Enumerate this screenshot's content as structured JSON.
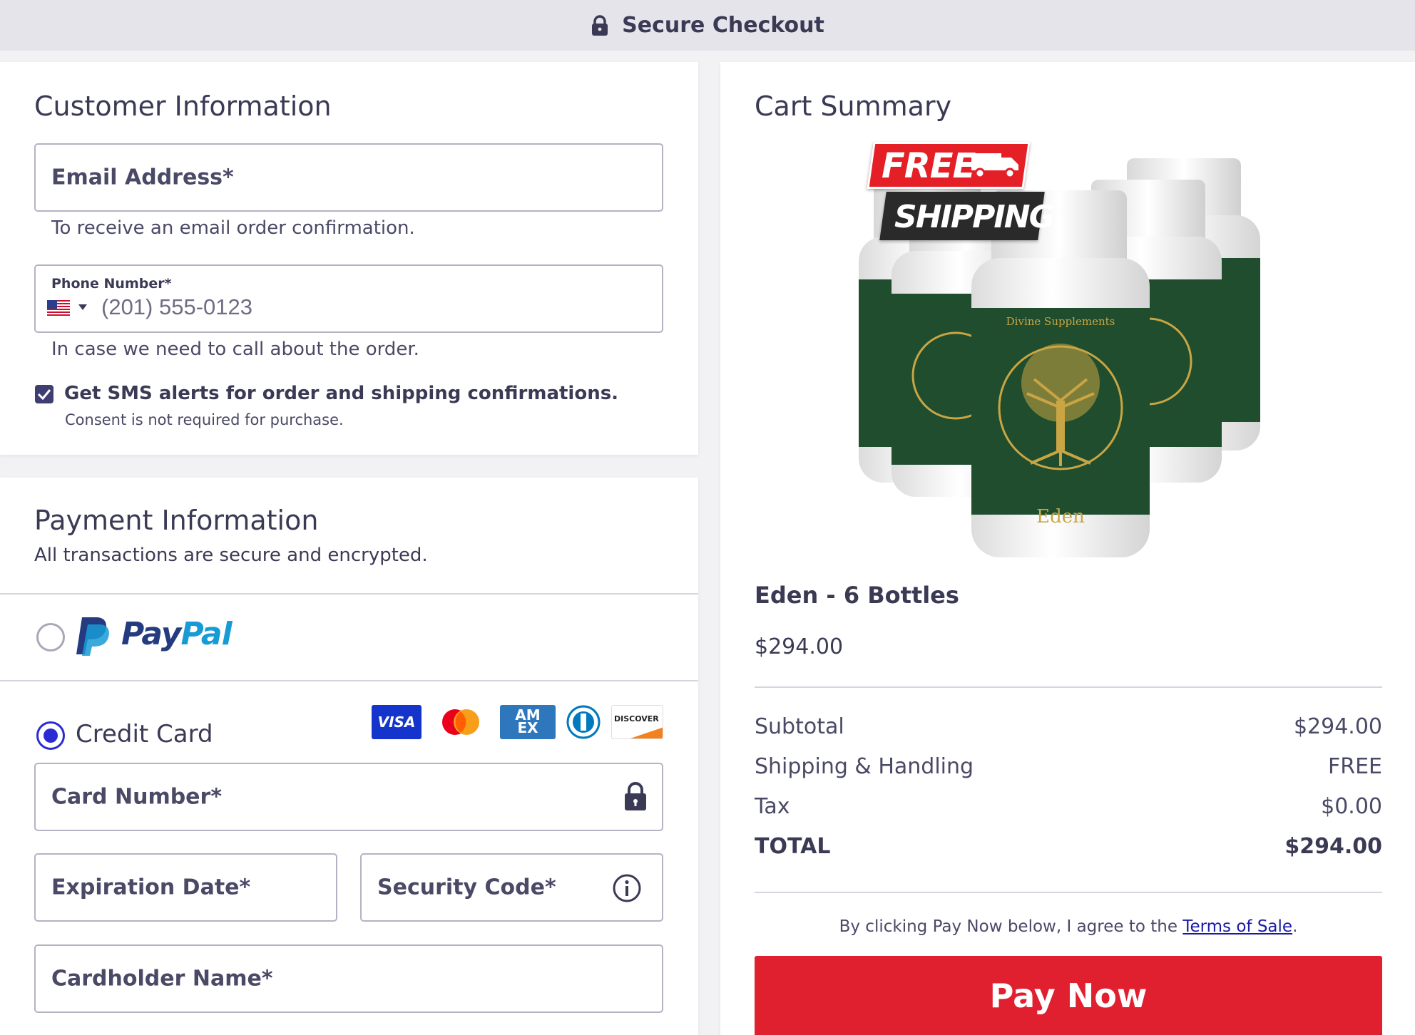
{
  "header": {
    "title": "Secure Checkout",
    "icon": "lock-icon"
  },
  "customer": {
    "heading": "Customer Information",
    "email_label": "Email Address*",
    "email_helper": "To receive an email order confirmation.",
    "phone_label": "Phone Number*",
    "phone_placeholder": "(201) 555-0123",
    "phone_country": "US",
    "phone_helper": "In case we need to call about the order.",
    "sms_label": "Get SMS alerts for order and shipping confirmations.",
    "sms_checked": true,
    "consent_note": "Consent is not required for purchase."
  },
  "payment": {
    "heading": "Payment Information",
    "subheading": "All transactions are secure and encrypted.",
    "paypal": {
      "pay": "Pay",
      "pal": "Pal",
      "selected": false
    },
    "credit_card": {
      "label": "Credit Card",
      "selected": true,
      "logos": {
        "visa": "VISA",
        "amex_top": "AM",
        "amex_bottom": "EX",
        "discover": "DISCOVER"
      }
    },
    "card_number_label": "Card Number*",
    "expiration_label": "Expiration Date*",
    "security_label": "Security Code*",
    "cardholder_label": "Cardholder Name*"
  },
  "cart": {
    "heading": "Cart Summary",
    "badge_free": "FREE",
    "badge_shipping": "SHIPPING",
    "bottle_brand": "Divine Supplements",
    "bottle_name": "Eden",
    "product_name": "Eden - 6 Bottles",
    "product_price": "$294.00",
    "rows": [
      {
        "label": "Subtotal",
        "value": "$294.00"
      },
      {
        "label": "Shipping & Handling",
        "value": "FREE"
      },
      {
        "label": "Tax",
        "value": "$0.00"
      }
    ],
    "total_label": "TOTAL",
    "total_value": "$294.00",
    "terms_prefix": "By clicking Pay Now below, I agree to the ",
    "terms_link": "Terms of Sale",
    "terms_suffix": ".",
    "pay_button": "Pay Now"
  },
  "colors": {
    "accent": "#2b2bd6",
    "pay_button": "#e0202e",
    "bottle": "#1f4d2e",
    "gold": "#c9a544"
  }
}
